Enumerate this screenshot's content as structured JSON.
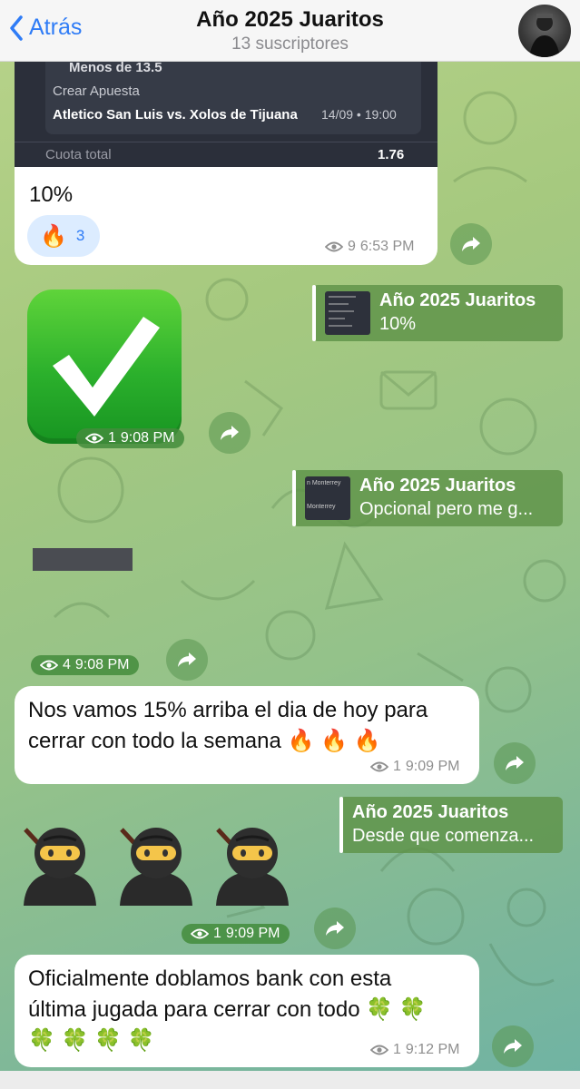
{
  "header": {
    "back_label": "Atrás",
    "title": "Año 2025 Juaritos",
    "subtitle": "13 suscriptores"
  },
  "bet_card": {
    "line_top": "Menos de 13.5",
    "label": "Crear Apuesta",
    "match": "Atletico San Luis vs. Xolos de Tijuana",
    "datetime": "14/09 • 19:00",
    "total_label": "Cuota total",
    "total_value": "1.76"
  },
  "messages": [
    {
      "text": "10%",
      "views": "9",
      "time": "6:53 PM",
      "reaction_emoji": "🔥",
      "reaction_count": "3"
    },
    {
      "views": "1",
      "time": "9:08 PM",
      "reply_title": "Año 2025 Juaritos",
      "reply_text": "10%"
    },
    {
      "views": "4",
      "time": "9:08 PM",
      "reply_title": "Año 2025 Juaritos",
      "reply_text": "Opcional pero me g...",
      "reply_thumb_text_1": "n Monterrey",
      "reply_thumb_text_2": "Monterrey"
    },
    {
      "text_line1": "Nos vamos 15% arriba el dia de hoy para",
      "text_line2": "cerrar con todo la semana 🔥 🔥 🔥",
      "views": "1",
      "time": "9:09 PM"
    },
    {
      "views": "1",
      "time": "9:09 PM",
      "reply_title": "Año 2025 Juaritos",
      "reply_text": "Desde que comenza..."
    },
    {
      "text_line1": "Oficialmente doblamos bank con esta",
      "text_line2": "última jugada para cerrar con todo 🍀 🍀",
      "text_line3": "🍀 🍀 🍀 🍀",
      "views": "1",
      "time": "9:12 PM"
    }
  ],
  "colors": {
    "accent": "#2f7cf6",
    "check_green": "#2bb02c",
    "reply_bg": "#5e9248"
  }
}
